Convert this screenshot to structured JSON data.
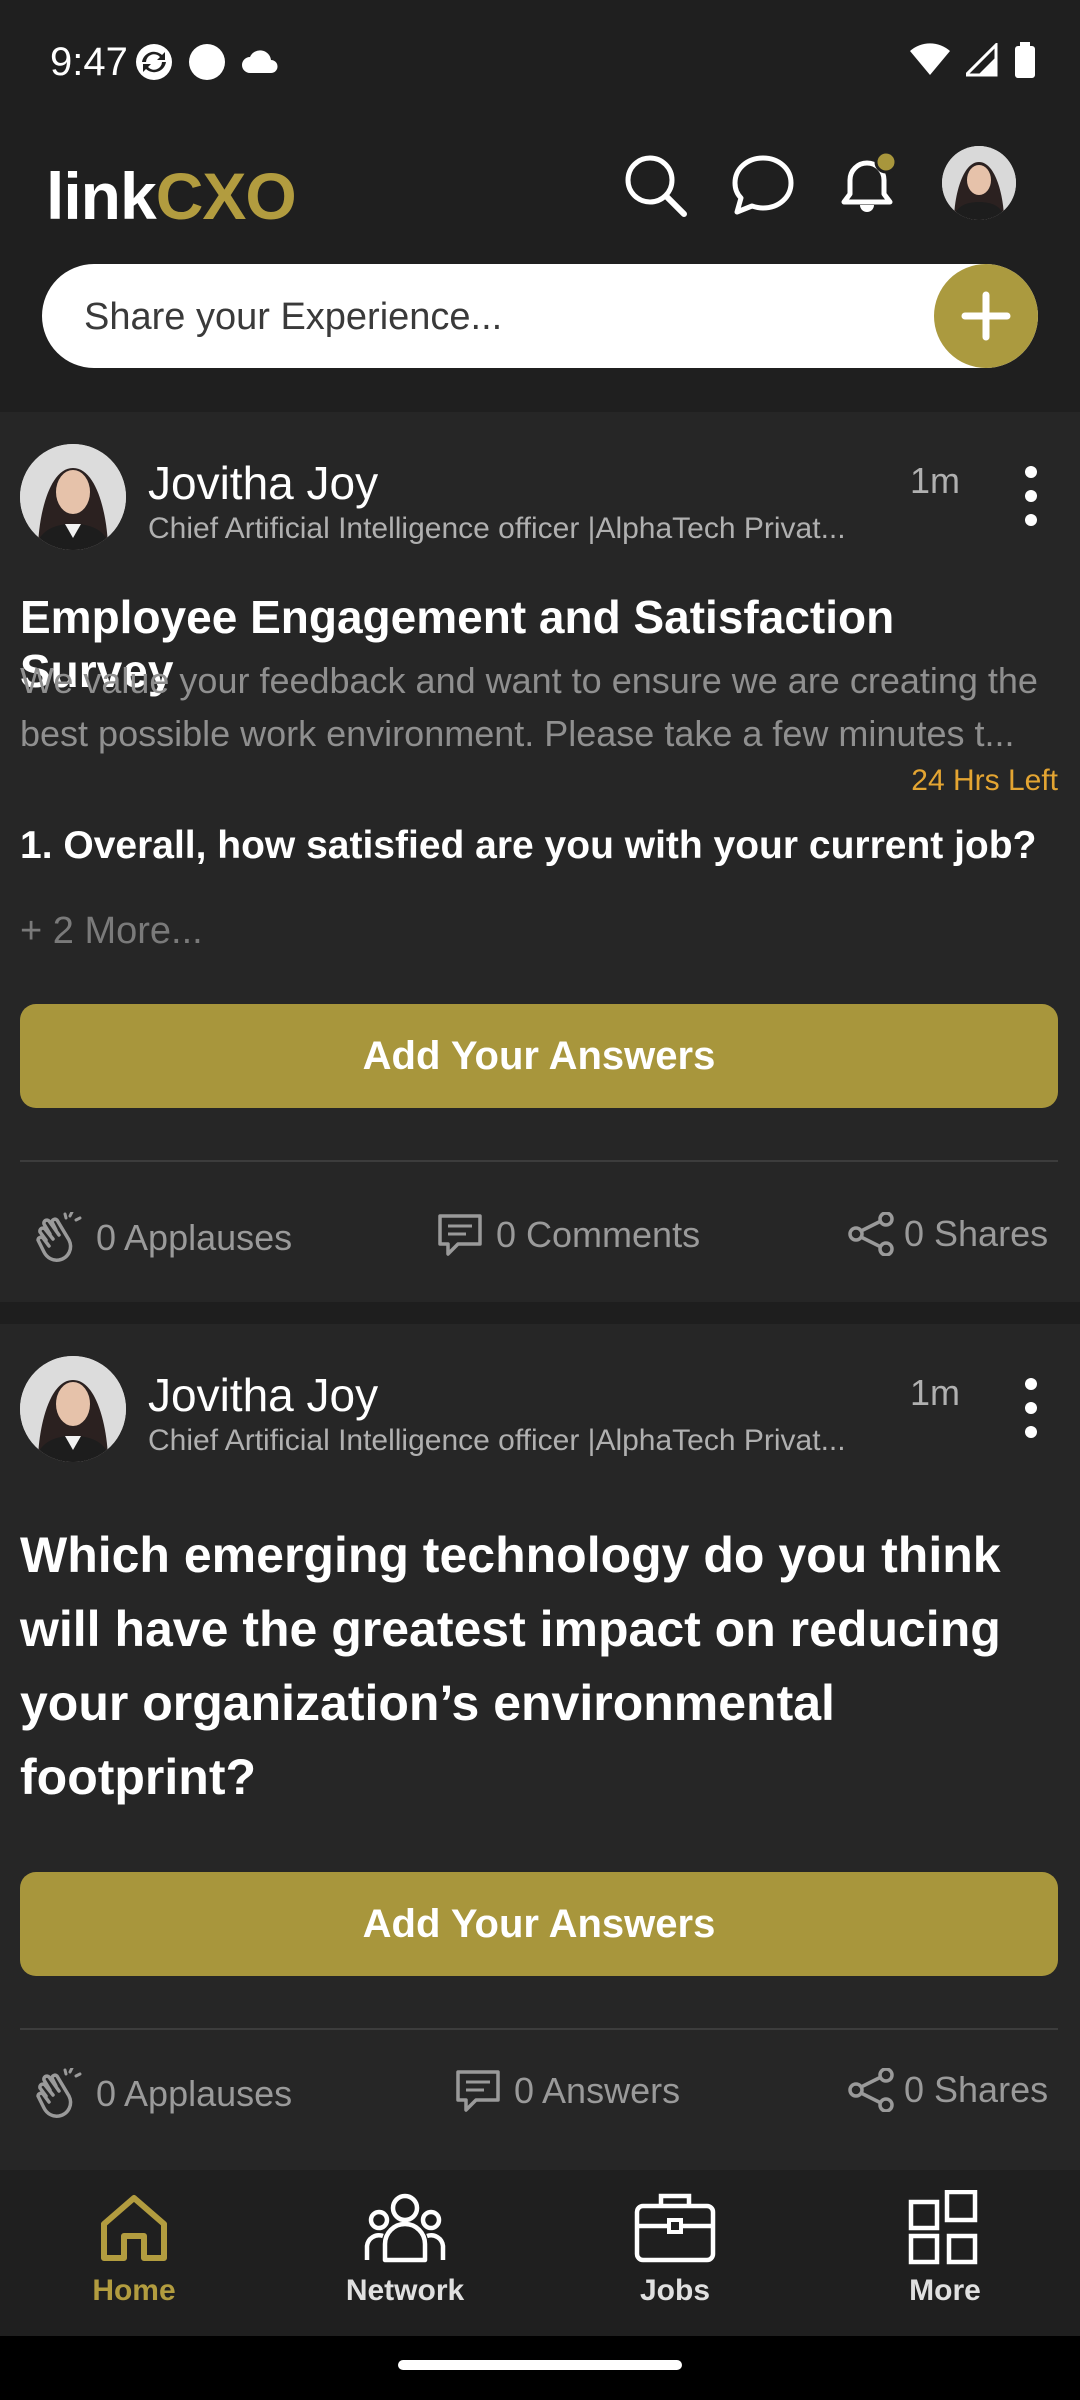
{
  "status_bar": {
    "time": "9:47"
  },
  "header": {
    "logo_link": "link",
    "logo_cxo": "CXO",
    "share_placeholder": "Share your Experience..."
  },
  "posts": [
    {
      "author": "Jovitha Joy",
      "role": "Chief Artificial Intelligence officer |AlphaTech Privat...",
      "time": "1m",
      "title": "Employee Engagement and Satisfaction Survey",
      "description": "We value your feedback and want to ensure we are creating the best possible work environment. Please take a few minutes t...",
      "time_left": "24 Hrs Left",
      "question": "1. Overall, how satisfied are you with your current job?",
      "more": "+ 2 More...",
      "button": "Add Your Answers",
      "applauses": "0 Applauses",
      "comments": "0 Comments",
      "shares": "0 Shares"
    },
    {
      "author": "Jovitha Joy",
      "role": "Chief Artificial Intelligence officer |AlphaTech Privat...",
      "time": "1m",
      "title": "Which emerging technology do you think will have the greatest impact on reducing your organization’s environmental footprint?",
      "button": "Add Your Answers",
      "applauses": "0 Applauses",
      "answers": "0 Answers",
      "shares": "0 Shares"
    }
  ],
  "bottom_nav": [
    {
      "label": "Home",
      "active": true
    },
    {
      "label": "Network",
      "active": false
    },
    {
      "label": "Jobs",
      "active": false
    },
    {
      "label": "More",
      "active": false
    }
  ],
  "colors": {
    "accent": "#a8963c",
    "time_left": "#e4a532",
    "background": "#262626"
  }
}
